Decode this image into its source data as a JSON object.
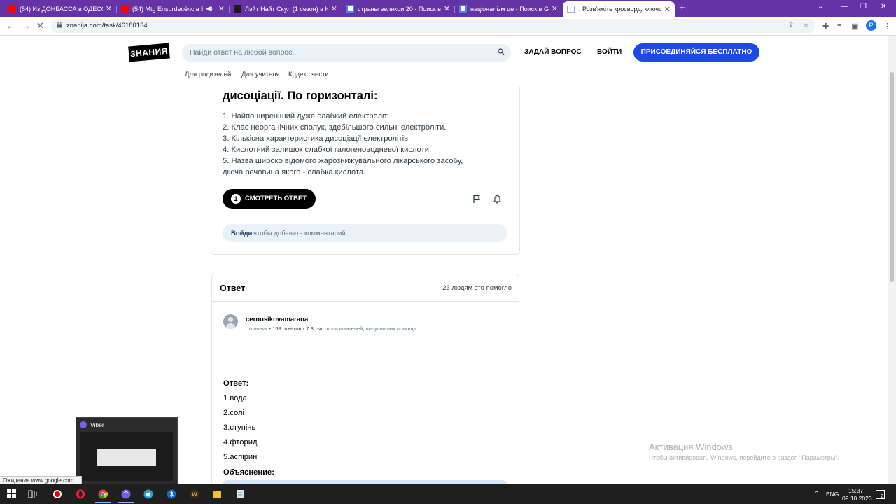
{
  "browser": {
    "tabs": [
      {
        "title": "(54) Из ДОНБАССА в ОДЕССУ и",
        "favicon": "youtube-icon",
        "active": false
      },
      {
        "title": "(54) Mtg Ensurdecência Estr",
        "favicon": "youtube-icon",
        "active": false
      },
      {
        "title": "Лэйт Найт Скул (1 сезон) в HD",
        "favicon": "film-icon",
        "active": false
      },
      {
        "title": "страны великои 20 - Поиск в G",
        "favicon": "google-icon",
        "active": false
      },
      {
        "title": "націоналізм це - Поиск в Goog",
        "favicon": "google-icon",
        "active": false
      },
      {
        "title": ". Розв'яжіть кросворд, ключов",
        "favicon": "loading-icon",
        "active": true
      }
    ],
    "url": "znanija.com/task/46180134",
    "profile_initial": "P"
  },
  "site": {
    "logo": "ЗНАНИЯ",
    "search_placeholder": "Найди ответ на любой вопрос...",
    "ask_label": "ЗАДАЙ ВОПРОС",
    "login_label": "ВОЙТИ",
    "join_label": "ПРИСОЕДИНЯЙСЯ БЕСПЛАТНО",
    "subnav": [
      "Для родителей",
      "Для учителя",
      "Кодекс чести"
    ]
  },
  "question": {
    "title_tail": "дисоціації. По горизонталі:",
    "lines": [
      "1. Найпоширеніший дуже слабкий електроліт.",
      "2. Клас неорганічних сполук, здебільшого сильні електроліти.",
      "3. Кількісна характеристика дисоціації електролітів.",
      "4. Кислотний залишок слабкої галогеноводневої кислоти.",
      "5. Назва широко відомого жарознижувального лікарського засобу,",
      "діюча речовина якого - слабка кислота."
    ],
    "answers_count": "1",
    "view_answer_label": "СМОТРЕТЬ ОТВЕТ",
    "comment_login": "Войди",
    "comment_rest": "чтобы добавить комментарий"
  },
  "answer": {
    "header": "Ответ",
    "helped": "23 людям это помогло",
    "user": {
      "name": "cernusikovamarana",
      "rank": "отличник",
      "answers": "168 ответов",
      "helped": "7.3 тыс.",
      "helped_suffix": "пользователей, получивших помощь"
    },
    "lead": "Ответ:",
    "items": [
      "1.вода",
      "2.солі",
      "3.ступінь",
      "4.фторид",
      "5.аспірин"
    ],
    "explanation": "Объяснение:"
  },
  "watermark": {
    "title": "Активация Windows",
    "subtitle": "Чтобы активировать Windows, перейдите в раздел \"Параметры\"."
  },
  "viber_preview": {
    "title": "Viber"
  },
  "status_text": "Ожидание www.google.com...",
  "tray": {
    "lang": "ENG",
    "time": "15:37",
    "date": "09.10.2023",
    "notifications": "2"
  }
}
